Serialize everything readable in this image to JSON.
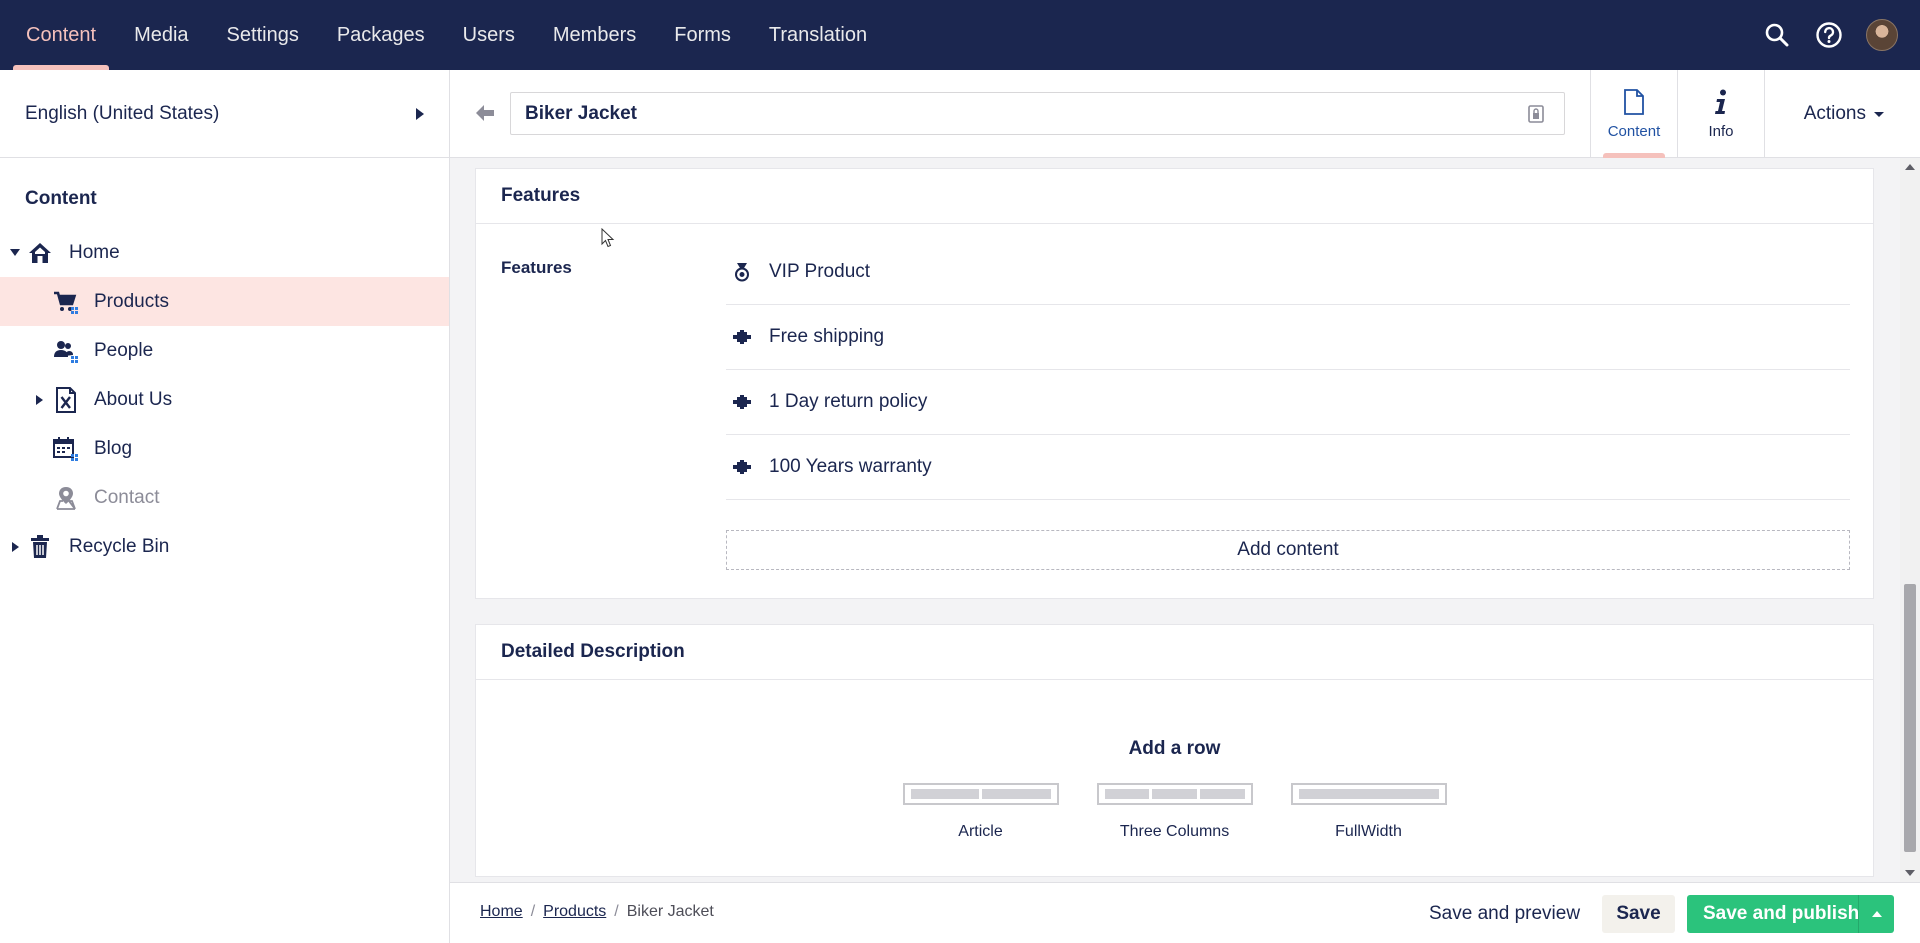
{
  "topnav": {
    "items": [
      {
        "label": "Content",
        "active": true
      },
      {
        "label": "Media"
      },
      {
        "label": "Settings"
      },
      {
        "label": "Packages"
      },
      {
        "label": "Users"
      },
      {
        "label": "Members"
      },
      {
        "label": "Forms"
      },
      {
        "label": "Translation"
      }
    ],
    "icons": [
      "search-icon",
      "help-icon",
      "avatar"
    ]
  },
  "sidebar": {
    "language": "English (United States)",
    "section_title": "Content",
    "tree": [
      {
        "label": "Home",
        "icon": "home-icon",
        "expanded": true
      },
      {
        "label": "Products",
        "icon": "cart-icon",
        "selected": true
      },
      {
        "label": "People",
        "icon": "people-icon"
      },
      {
        "label": "About Us",
        "icon": "document-x-icon",
        "has_children": true
      },
      {
        "label": "Blog",
        "icon": "calendar-icon"
      },
      {
        "label": "Contact",
        "icon": "map-pin-icon",
        "muted": true
      },
      {
        "label": "Recycle Bin",
        "icon": "trash-icon",
        "has_children": true
      }
    ]
  },
  "editor": {
    "name": "Biker Jacket",
    "apps": [
      {
        "label": "Content",
        "icon": "document-icon",
        "active": true
      },
      {
        "label": "Info",
        "icon": "info-icon"
      }
    ],
    "actions_label": "Actions"
  },
  "features_panel": {
    "title": "Features",
    "property_label": "Features",
    "blocks": [
      {
        "label": "VIP Product",
        "icon": "medal-icon"
      },
      {
        "label": "Free shipping",
        "icon": "puzzle-icon"
      },
      {
        "label": "1 Day return policy",
        "icon": "puzzle-icon"
      },
      {
        "label": "100 Years warranty",
        "icon": "puzzle-icon"
      }
    ],
    "add_content_label": "Add content"
  },
  "description_panel": {
    "title": "Detailed Description",
    "add_row_label": "Add a row",
    "layouts": [
      {
        "label": "Article",
        "columns": 2
      },
      {
        "label": "Three Columns",
        "columns": 3
      },
      {
        "label": "FullWidth",
        "columns": 1
      }
    ]
  },
  "footer": {
    "breadcrumb": [
      {
        "label": "Home",
        "link": true
      },
      {
        "label": "Products",
        "link": true
      },
      {
        "label": "Biker Jacket",
        "link": false
      }
    ],
    "separator": "/",
    "save_preview_label": "Save and preview",
    "save_label": "Save",
    "publish_label": "Save and publish"
  },
  "colors": {
    "nav_bg": "#1b264f",
    "accent_pink": "#f5c1bc",
    "selected_bg": "#fde5e2",
    "publish_green": "#2bc37c",
    "active_blue": "#2152a3"
  }
}
